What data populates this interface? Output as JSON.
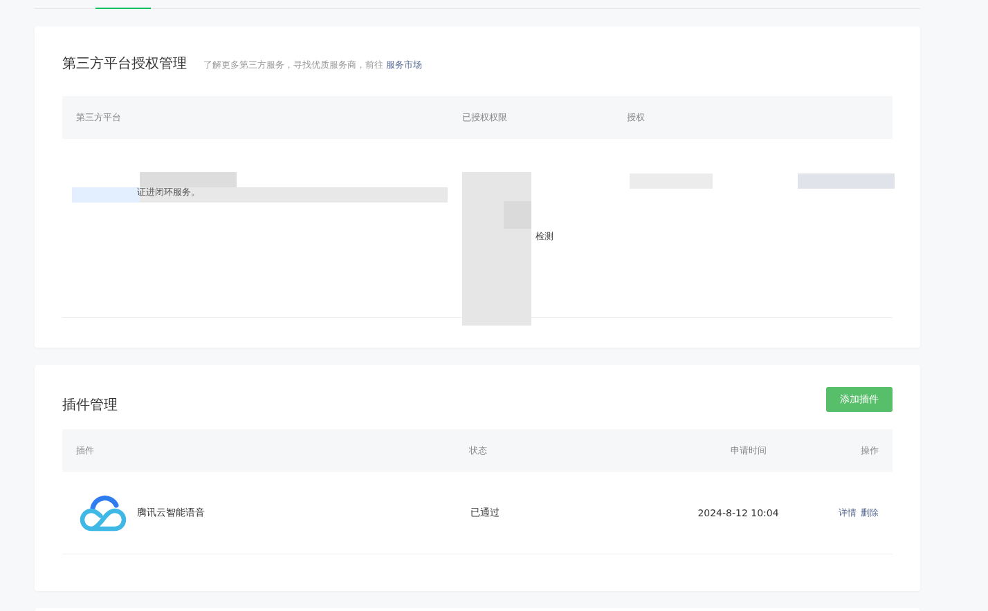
{
  "auth_section": {
    "title": "第三方平台授权管理",
    "hint": "了解更多第三方服务，寻找优质服务商，前往",
    "hint_link": "服务市场",
    "columns": [
      "第三方平台",
      "已授权权限",
      "授权"
    ],
    "rows": [
      {
        "description": "证进闭环服务。",
        "permissions": [
          "检测"
        ]
      }
    ]
  },
  "plugin_section": {
    "title": "插件管理",
    "add_button": "添加插件",
    "columns": [
      "插件",
      "状态",
      "申请时间",
      "操作"
    ],
    "rows": [
      {
        "name": "腾讯云智能语音",
        "status": "已通过",
        "applied_at": "2024-8-12 10:04",
        "actions": [
          "详情",
          "删除"
        ]
      }
    ]
  }
}
